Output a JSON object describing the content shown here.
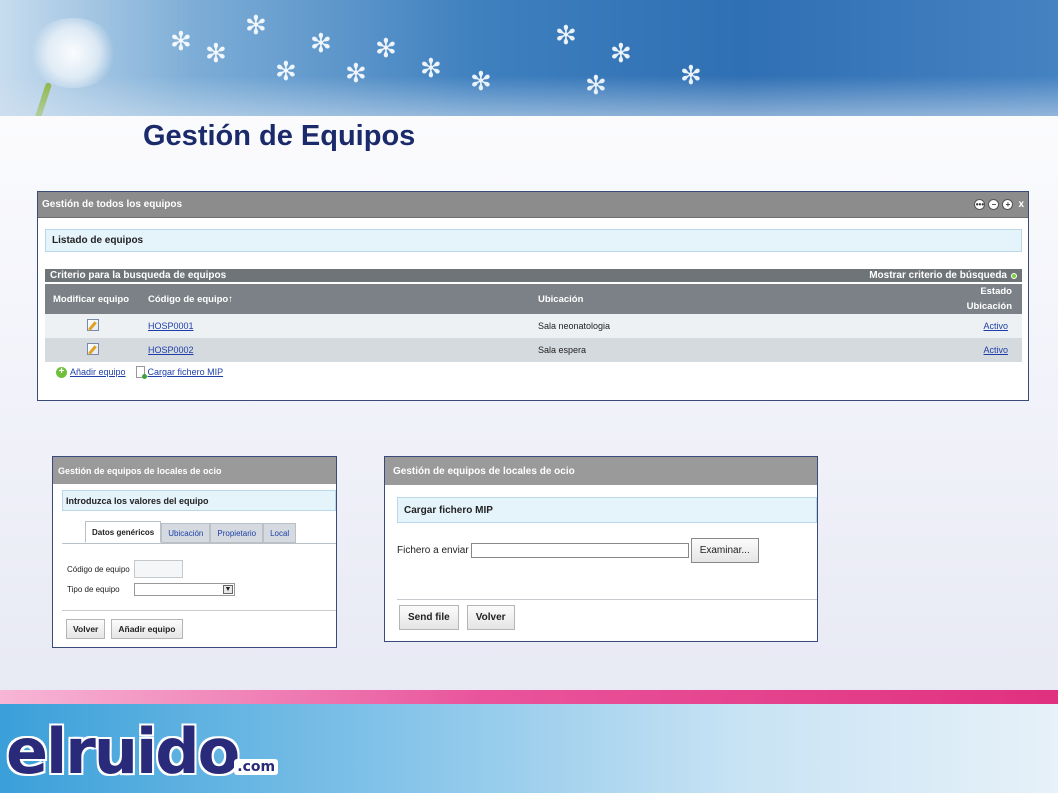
{
  "page": {
    "title": "Gestión de Equipos"
  },
  "main_portlet": {
    "title": "Gestión de todos los equipos",
    "window_icons": [
      "more-icon",
      "minimize-icon",
      "restore-icon",
      "close-icon"
    ],
    "close_glyph": "x",
    "list_section_title": "Listado de equipos",
    "criteria_bar": {
      "label": "Criterio para la busqueda de equipos",
      "toggle_label": "Mostrar criterio de búsqueda"
    },
    "table": {
      "headers": {
        "edit": "Modificar equipo",
        "code": "Código de equipo↑",
        "location": "Ubicación",
        "status_line1": "Estado",
        "status_line2": "Ubicación"
      },
      "rows": [
        {
          "code": "HOSP0001",
          "location": "Sala neonatologia",
          "status": "Activo"
        },
        {
          "code": "HOSP0002",
          "location": "Sala espera",
          "status": "Activo"
        }
      ]
    },
    "footer": {
      "add_label": "Añadir equipo",
      "upload_label": "Cargar fichero MIP"
    }
  },
  "panel_form": {
    "title": "Gestión de equipos de locales de ocio",
    "section_title": "Introduzca los valores del equipo",
    "tabs": [
      "Datos genéricos",
      "Ubicación",
      "Propietario",
      "Local"
    ],
    "active_tab": "Datos genéricos",
    "fields": {
      "code_label": "Código de equipo",
      "code_value": "",
      "type_label": "Tipo de equipo",
      "type_value": ""
    },
    "buttons": {
      "back": "Volver",
      "add": "Añadir equipo"
    }
  },
  "panel_upload": {
    "title": "Gestión de equipos de locales de ocio",
    "section_title": "Cargar fichero MIP",
    "file_label": "Fichero a enviar",
    "file_value": "",
    "browse_label": "Examinar...",
    "buttons": {
      "send": "Send file",
      "back": "Volver"
    }
  },
  "footer_logo": {
    "main": "elruido",
    "tld": ".com"
  },
  "colors": {
    "title": "#1b2a6b",
    "portlet_header": "#8c8c8c",
    "section_bg": "#e5f3fb",
    "link": "#1f3fa8",
    "pink_bar": "#e0307f",
    "footer_blue": "#3aa0d9"
  }
}
